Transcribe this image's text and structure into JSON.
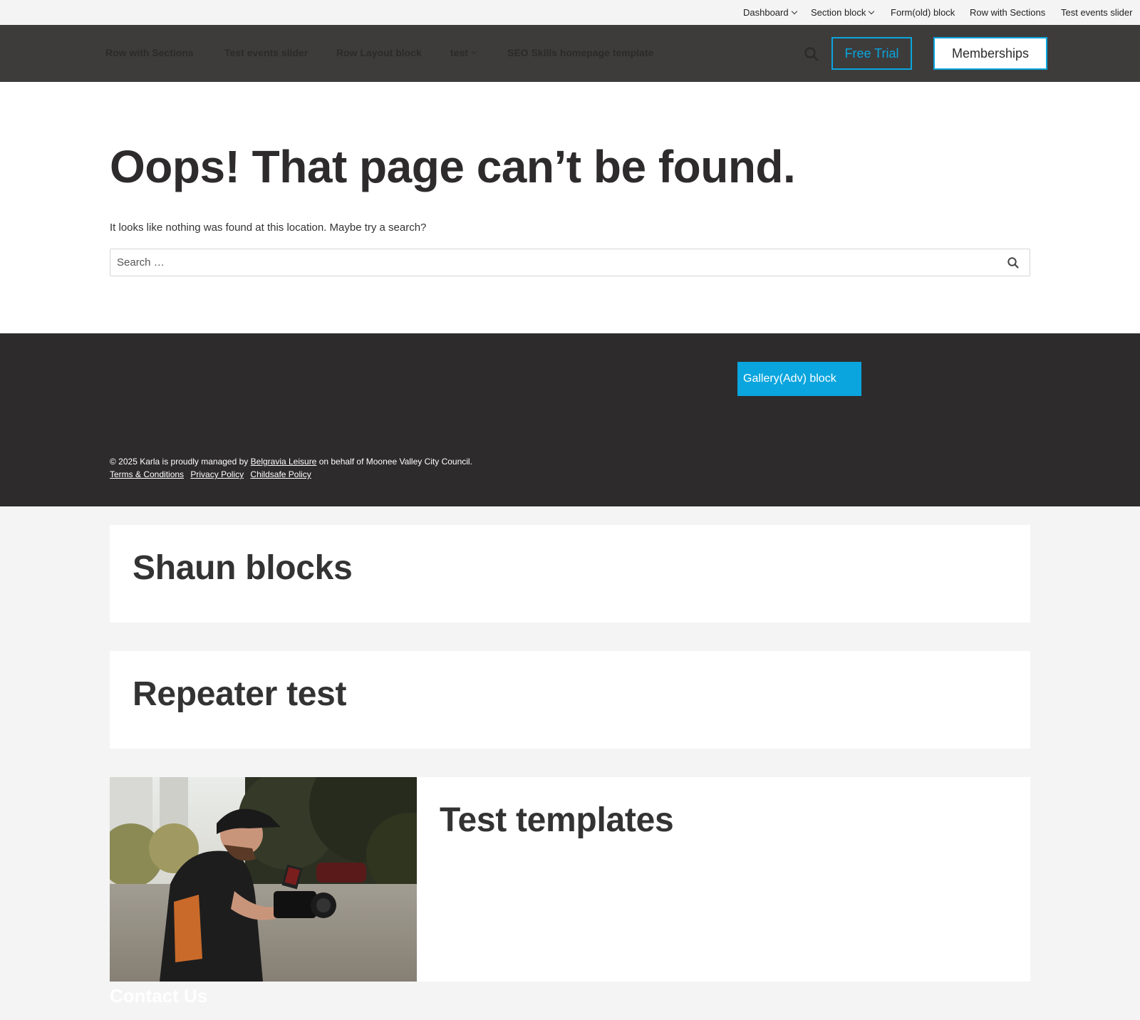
{
  "topbar": {
    "items": [
      {
        "label": "Dashboard",
        "has_dropdown": true
      },
      {
        "label": "Section block",
        "has_dropdown": true
      },
      {
        "label": "Form(old) block",
        "has_dropdown": false
      },
      {
        "label": "Row with Sections",
        "has_dropdown": false
      },
      {
        "label": "Test events slider",
        "has_dropdown": false
      }
    ]
  },
  "header": {
    "nav": [
      {
        "label": "Row with Sections"
      },
      {
        "label": "Test events slider"
      },
      {
        "label": "Row Layout block"
      },
      {
        "label": "test",
        "has_dropdown": true
      },
      {
        "label": "SEO Skills homepage template"
      }
    ],
    "search_icon": "search-icon",
    "free_trial_label": "Free Trial",
    "memberships_label": "Memberships"
  },
  "main": {
    "title": "Oops! That page can’t be found.",
    "message": "It looks like nothing was found at this location. Maybe try a search?",
    "search_placeholder": "Search …"
  },
  "footer": {
    "gallery_button": "Gallery(Adv) block",
    "copyright_prefix": "© 2025 Karla is proudly managed by",
    "copyright_link": "Belgravia Leisure",
    "copyright_suffix": "on behalf of Moonee Valley City Council.",
    "links": [
      "Terms & Conditions",
      "Privacy Policy",
      "Childsafe Policy"
    ]
  },
  "cards": [
    {
      "title": "Shaun blocks"
    },
    {
      "title": "Repeater test"
    },
    {
      "title": "Test templates"
    }
  ],
  "contact_heading": "Contact Us",
  "colors": {
    "accent": "#0aa5de",
    "header_bg": "#3d3c3b",
    "footer_bg": "#2d2b2b",
    "page_bg": "#f4f4f4"
  }
}
